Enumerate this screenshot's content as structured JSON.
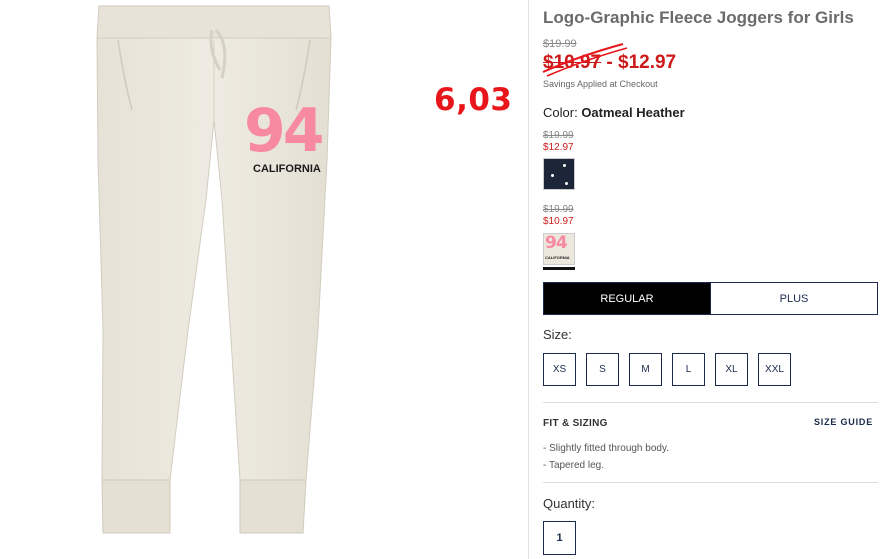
{
  "product": {
    "title": "Logo-Graphic Fleece Joggers for Girls",
    "original_price": "$19.99",
    "sale_price_low": "$10.97",
    "sale_price_separator": " - ",
    "sale_price_high": "$12.97",
    "savings_note": "Savings Applied at Checkout",
    "image_graphic": {
      "number": "94",
      "text": "CALIFORNIA"
    }
  },
  "annotation": {
    "text": "6,03",
    "color": "#e8161a"
  },
  "color_selector": {
    "label": "Color:",
    "selected": "Oatmeal Heather",
    "swatches": [
      {
        "name": "navy",
        "original_price": "$19.99",
        "sale_price": "$12.97",
        "color": "#1d2638"
      },
      {
        "name": "oatmeal-heather",
        "original_price": "$19.99",
        "sale_price": "$10.97",
        "color": "#ece8de",
        "graphic_number": "94",
        "graphic_text": "CALIFORNIA"
      }
    ]
  },
  "fit_tabs": [
    {
      "label": "REGULAR",
      "active": true
    },
    {
      "label": "PLUS",
      "active": false
    }
  ],
  "size_selector": {
    "label": "Size:",
    "options": [
      "XS",
      "S",
      "M",
      "L",
      "XL",
      "XXL"
    ]
  },
  "fit_sizing": {
    "heading": "FIT & SIZING",
    "link": "SIZE GUIDE",
    "bullets": [
      "Slightly fitted through body.",
      "Tapered leg."
    ]
  },
  "quantity": {
    "label": "Quantity:",
    "value": "1"
  },
  "colors": {
    "sale_red": "#cc1a1a",
    "navy": "#1a2a4a",
    "fleece": "#ece8de",
    "graphic_pink": "#f78aa0"
  }
}
